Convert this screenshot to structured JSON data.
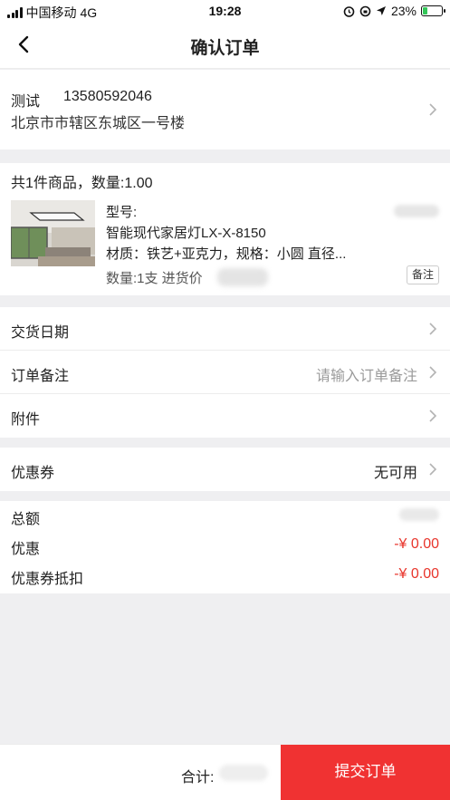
{
  "status_bar": {
    "carrier": "中国移动",
    "network": "4G",
    "time": "19:28",
    "battery": "23%",
    "battery_level": 0.23
  },
  "nav": {
    "title": "确认订单",
    "back_icon": "chevron-left-icon"
  },
  "address": {
    "name": "测试",
    "phone": "13580592046",
    "detail": "北京市市辖区东城区一号楼",
    "chevron_icon": "chevron-right-icon"
  },
  "goods": {
    "summary": "共1件商品，数量:1.00",
    "items": [
      {
        "model_label": "型号:",
        "name": "智能现代家居灯LX-X-8150",
        "spec": "材质：铁艺+亚克力，规格：小圆 直径...",
        "qty_line": "数量:1支 进货价",
        "note_button": "备注"
      }
    ]
  },
  "rows": [
    {
      "label": "交货日期",
      "value": ""
    },
    {
      "label": "订单备注",
      "value": "请输入订单备注"
    },
    {
      "label": "附件",
      "value": ""
    }
  ],
  "coupon": {
    "label": "优惠券",
    "value": "无可用"
  },
  "totals": {
    "total_label": "总额",
    "discount_label": "优惠",
    "discount_value": "-¥ 0.00",
    "coupon_label": "优惠券抵扣",
    "coupon_value": "-¥ 0.00"
  },
  "footer": {
    "sum_label": "合计:",
    "submit_label": "提交订单"
  },
  "colors": {
    "accent": "#f03232",
    "price_red": "#e8352c",
    "background": "#efeff1"
  }
}
